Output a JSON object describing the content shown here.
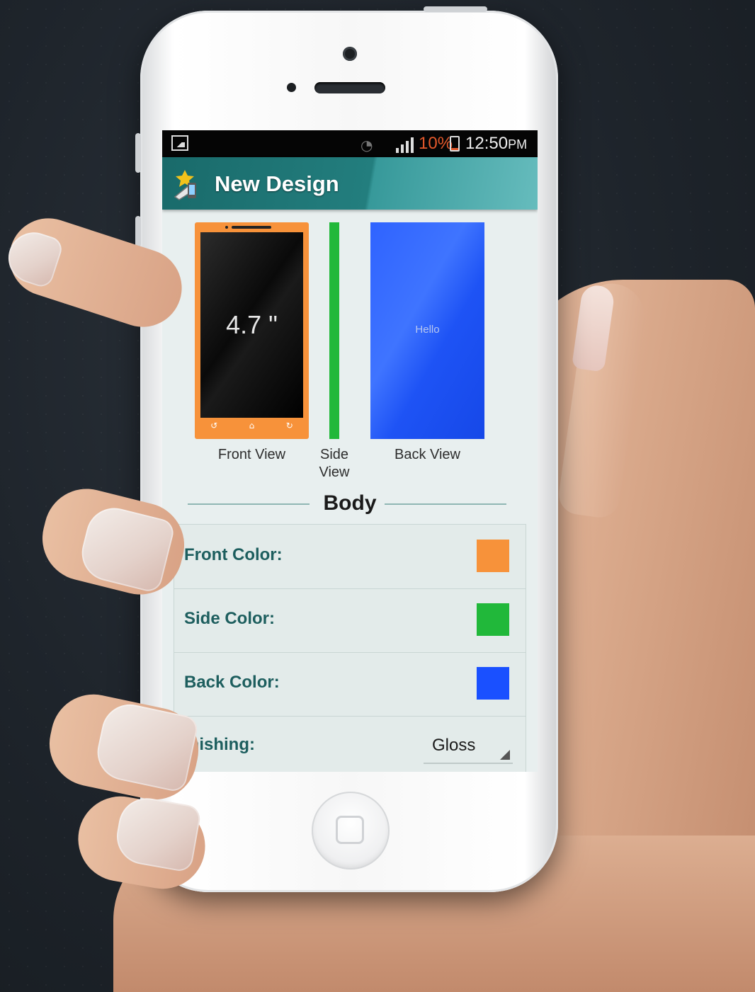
{
  "statusbar": {
    "battery_percent": "10%",
    "time": "12:50",
    "ampm": "PM"
  },
  "actionbar": {
    "title": "New Design"
  },
  "preview": {
    "front_size": "4.7 \"",
    "back_text": "Hello",
    "front_label": "Front View",
    "side_label_line1": "Side",
    "side_label_line2": "View",
    "back_label": "Back View"
  },
  "section": {
    "title": "Body"
  },
  "settings": {
    "front_color_label": "Front Color:",
    "side_color_label": "Side Color:",
    "back_color_label": "Back Color:",
    "finishing_label": "inishing:",
    "finishing_value": "Gloss"
  },
  "colors": {
    "front": "#f7923a",
    "side": "#21b83a",
    "back": "#1a50ff",
    "actionbar": "#196a6a",
    "battery_text": "#e2582b"
  },
  "icons": [
    "image-notification-icon",
    "wifi-icon",
    "signal-icon",
    "battery-icon",
    "app-icon",
    "spinner-arrow-icon"
  ]
}
